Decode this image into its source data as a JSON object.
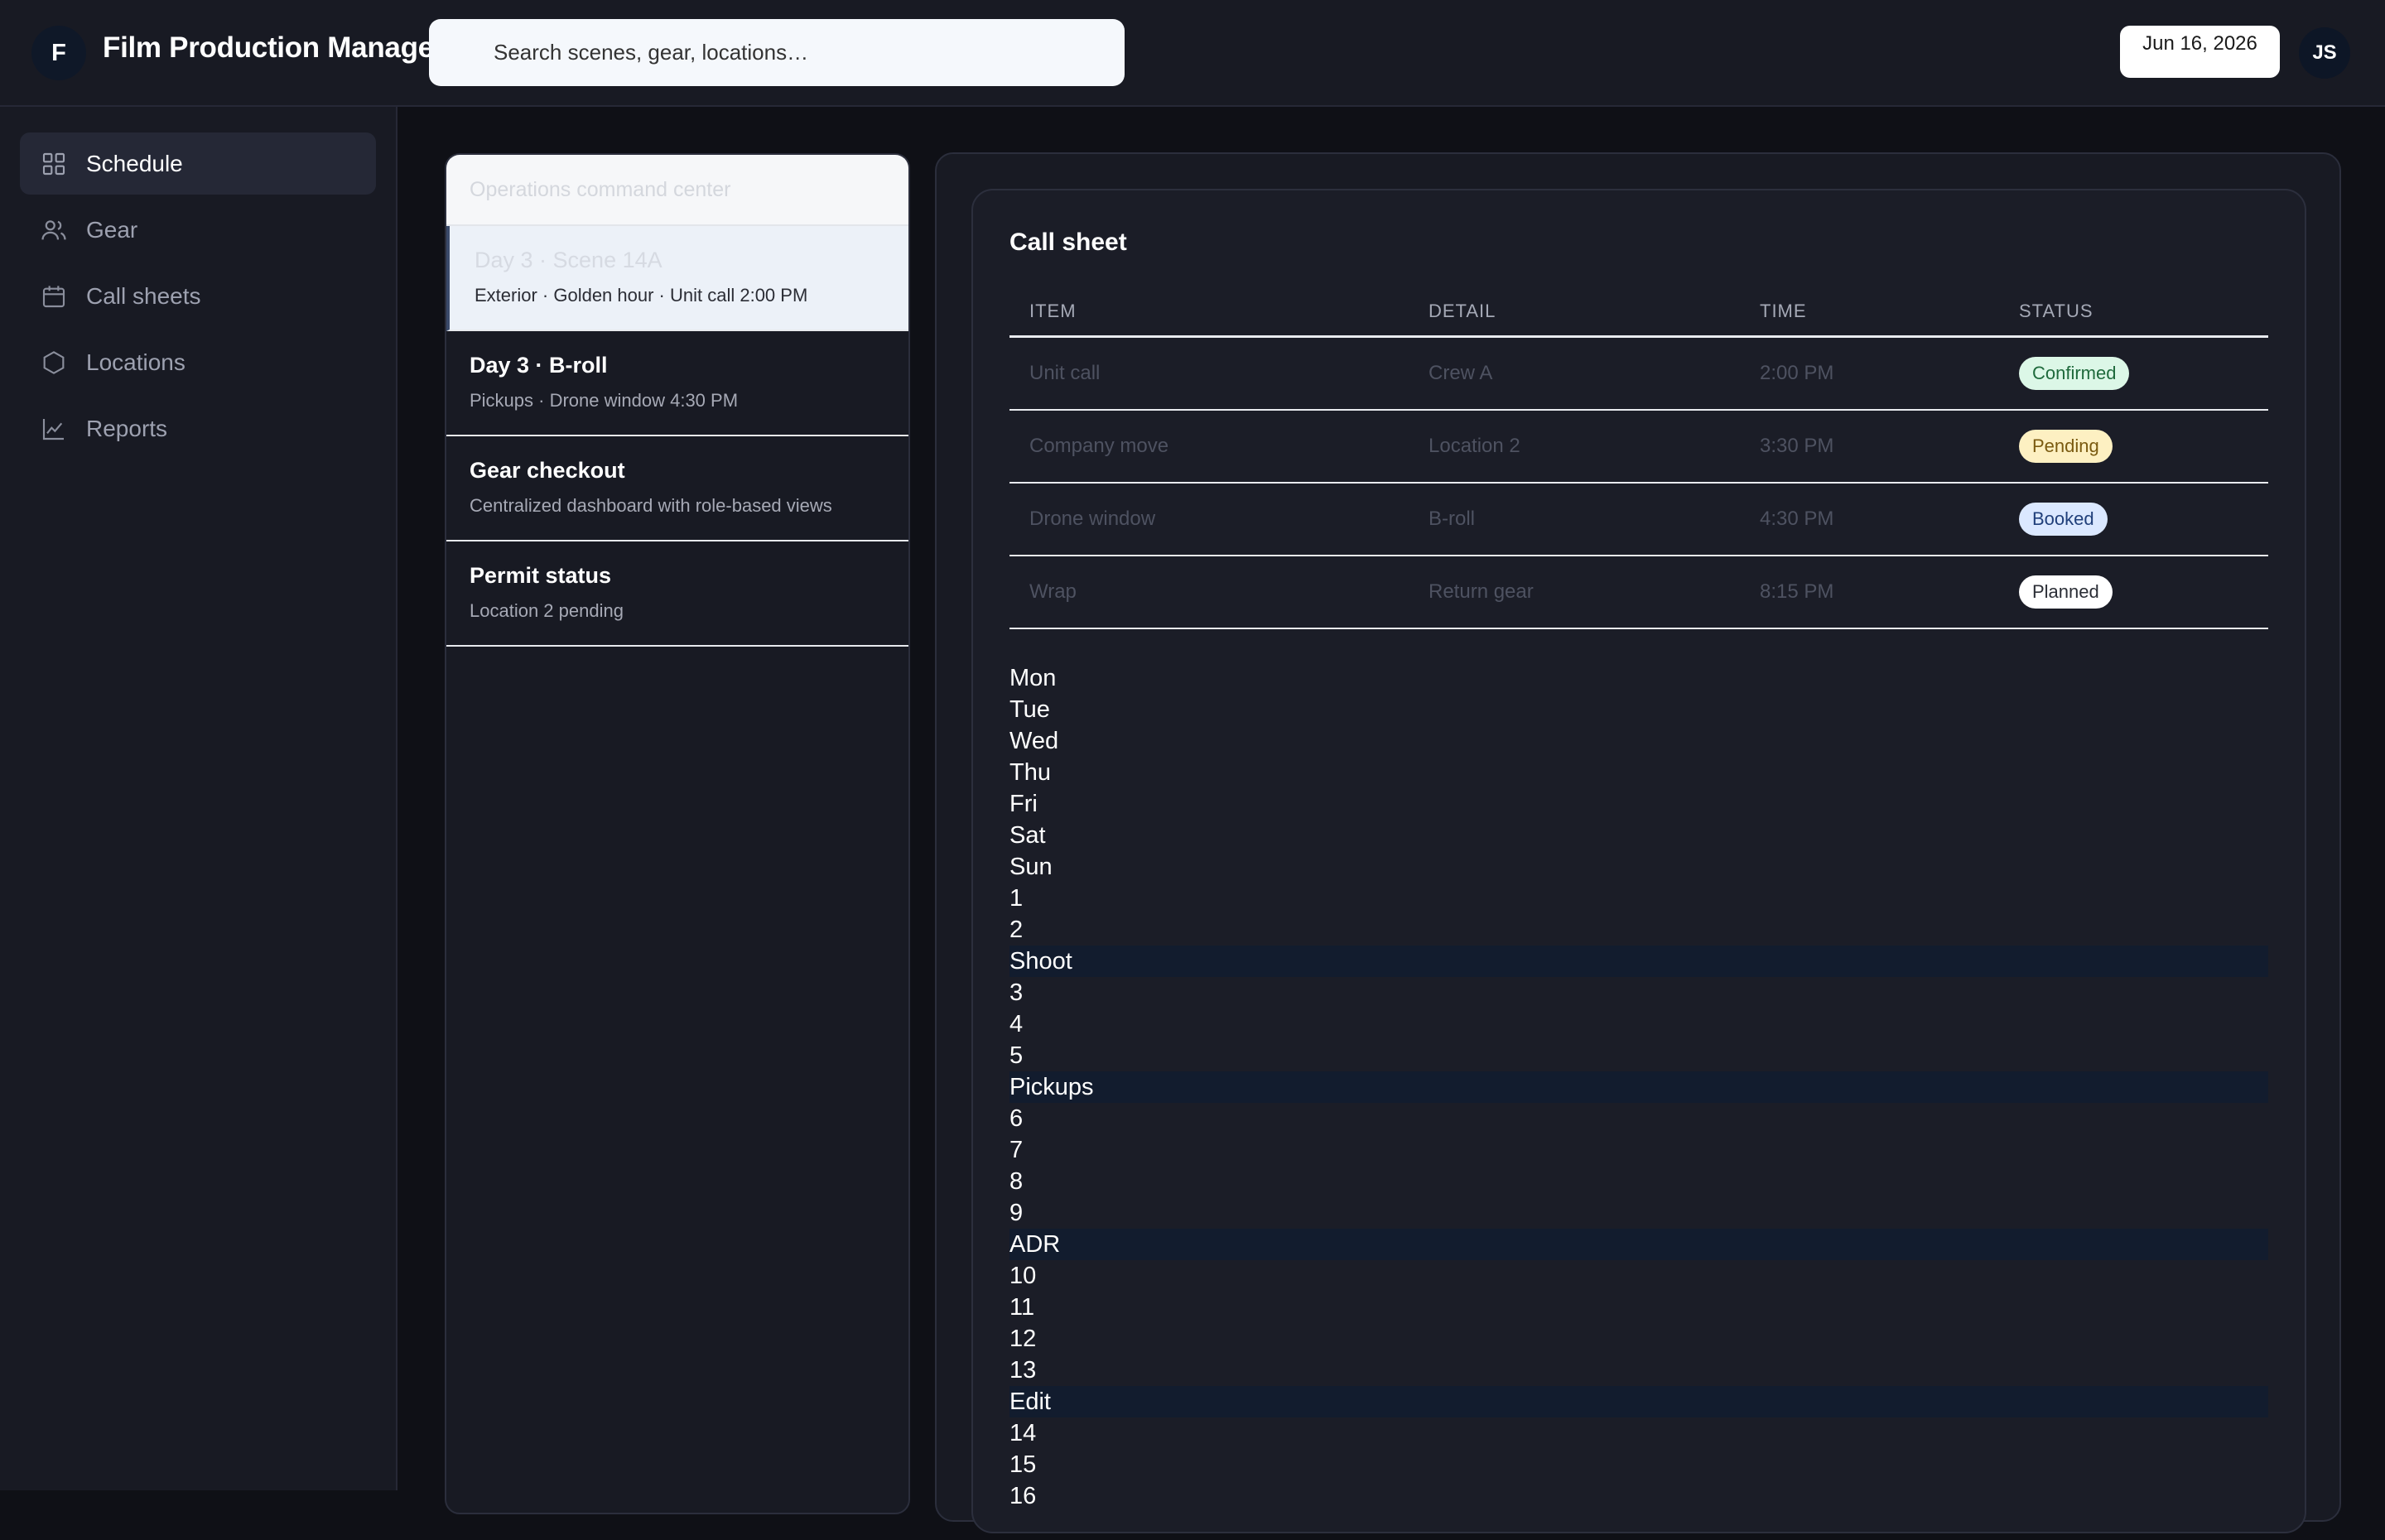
{
  "app": {
    "logo_letter": "F",
    "title": "Film Production Manager",
    "search_placeholder": "Search scenes, gear, locations…",
    "date": "Jun 16, 2026",
    "user_initials": "JS"
  },
  "sidebar": {
    "items": [
      {
        "label": "Schedule",
        "icon": "grid-icon",
        "active": true
      },
      {
        "label": "Gear",
        "icon": "users-icon",
        "active": false
      },
      {
        "label": "Call sheets",
        "icon": "calendar-icon",
        "active": false
      },
      {
        "label": "Locations",
        "icon": "hexagon-icon",
        "active": false
      },
      {
        "label": "Reports",
        "icon": "chart-line-icon",
        "active": false
      }
    ]
  },
  "list": {
    "header": "Operations command center",
    "items": [
      {
        "title": "Day 3 · Scene 14A",
        "subtitle": "Exterior · Golden hour · Unit call 2:00 PM"
      },
      {
        "title": "Day 3 · B-roll",
        "subtitle": "Pickups · Drone window 4:30 PM"
      },
      {
        "title": "Gear checkout",
        "subtitle": "Centralized dashboard with role-based views"
      },
      {
        "title": "Permit status",
        "subtitle": "Location 2 pending"
      }
    ]
  },
  "callsheet": {
    "title": "Call sheet",
    "columns": [
      "ITEM",
      "DETAIL",
      "TIME",
      "STATUS"
    ],
    "rows": [
      {
        "item": "Unit call",
        "detail": "Crew A",
        "time": "2:00 PM",
        "status": "Confirmed",
        "status_color": "#dcf7e7"
      },
      {
        "item": "Company move",
        "detail": "Location 2",
        "time": "3:30 PM",
        "status": "Pending",
        "status_color": "#fdf0c2"
      },
      {
        "item": "Drone window",
        "detail": "B-roll",
        "time": "4:30 PM",
        "status": "Booked",
        "status_color": "#dbe8ff"
      },
      {
        "item": "Wrap",
        "detail": "Return gear",
        "time": "8:15 PM",
        "status": "Planned",
        "status_color": "#ffffff"
      }
    ]
  },
  "calendar": {
    "weekdays": [
      "Mon",
      "Tue",
      "Wed",
      "Thu",
      "Fri",
      "Sat",
      "Sun"
    ],
    "entries": [
      "1",
      "2",
      "Shoot",
      "3",
      "4",
      "5",
      "Pickups",
      "6",
      "7",
      "8",
      "9",
      "ADR",
      "10",
      "11",
      "12",
      "13",
      "Edit",
      "14",
      "15",
      "16"
    ],
    "event_labels": [
      "Shoot",
      "Pickups",
      "ADR",
      "Edit"
    ]
  }
}
